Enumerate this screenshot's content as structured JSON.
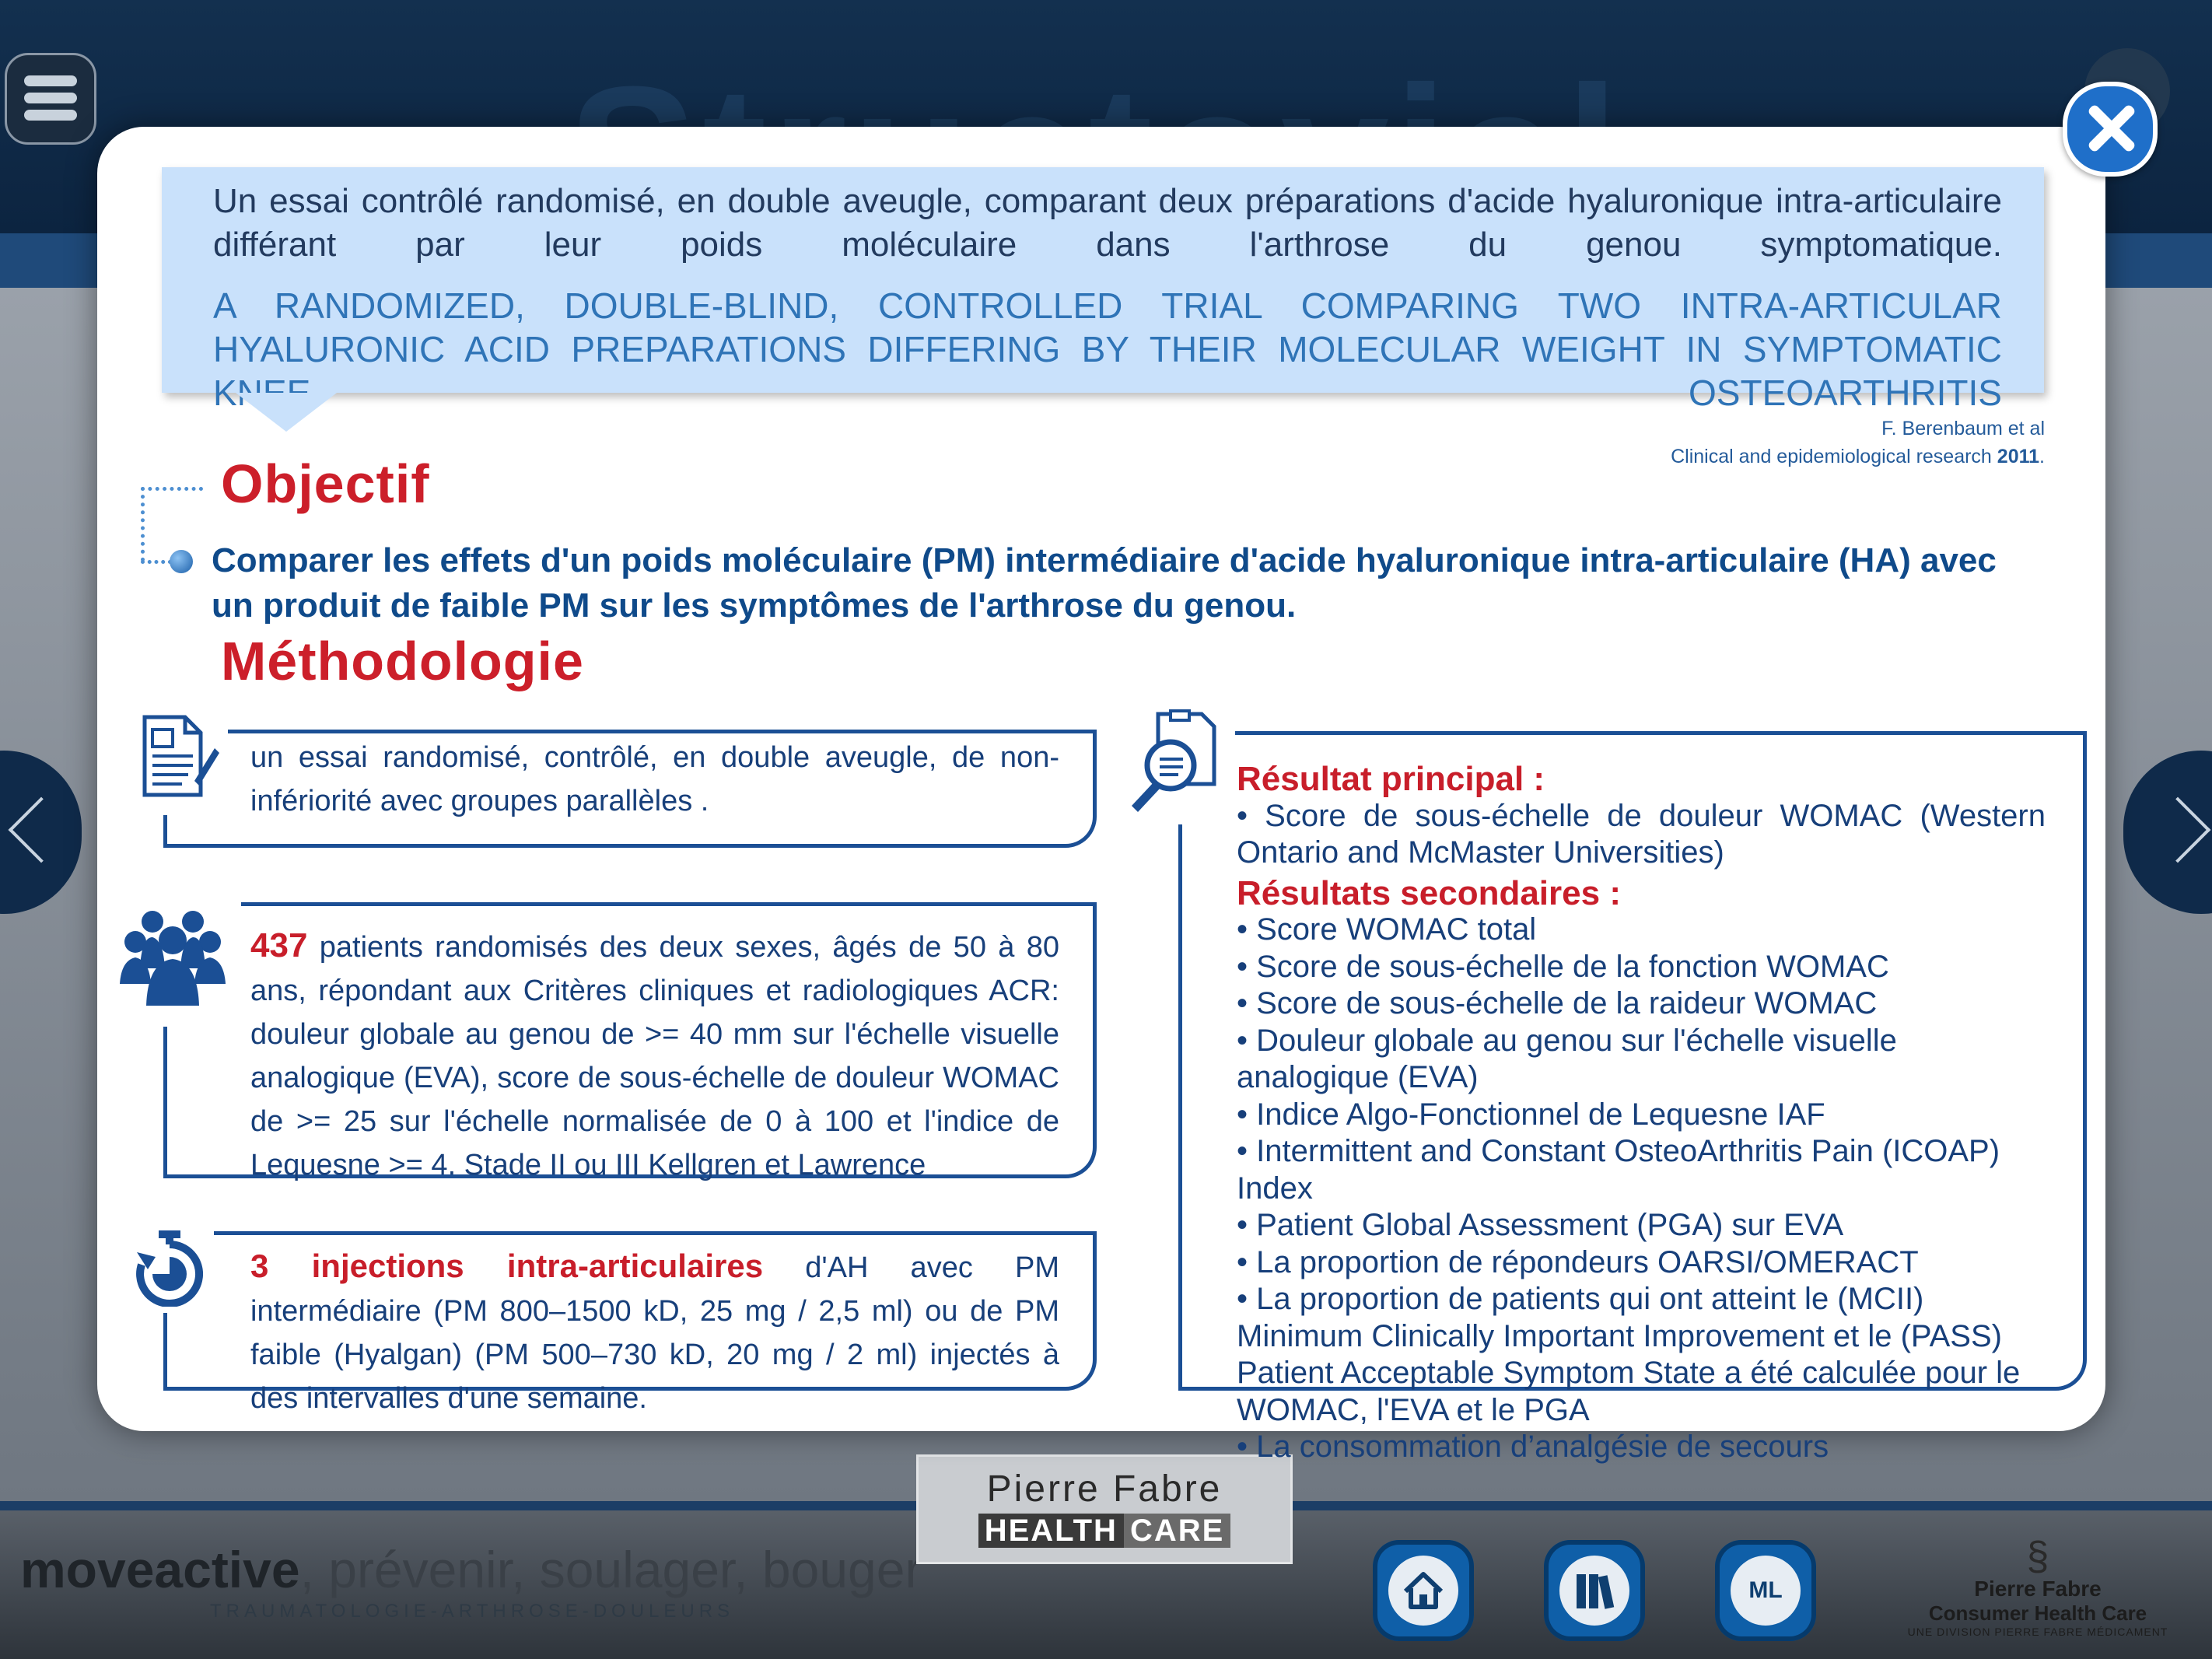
{
  "app": {
    "background_title": "Structovial",
    "brand": {
      "bold": "moveactive",
      "tagline": ", prévenir, soulager, bouger",
      "subtitle": "TRAUMATOLOGIE-ARTHROSE-DOULEURS"
    },
    "center_logo": {
      "line1": "Pierre Fabre",
      "line2a": "HEALTH",
      "line2b": "CARE"
    },
    "right_logo": {
      "line1": "Pierre Fabre",
      "line2": "Consumer Health Care",
      "line3": "UNE DIVISION PIERRE FABRE MÉDICAMENT"
    },
    "footer_buttons": [
      {
        "icon": "home-icon"
      },
      {
        "icon": "library-icon"
      },
      {
        "icon": "ml-icon",
        "label": "ML"
      }
    ],
    "colors": {
      "accent_red": "#cc1f2a",
      "accent_blue": "#1b4f95",
      "title_bg": "#c9e1fb"
    }
  },
  "modal": {
    "title_fr": "Un essai contrôlé randomisé, en double aveugle, comparant deux préparations d'acide hyaluronique intra-articulaire différant par leur poids moléculaire dans l'arthrose du genou symptomatique.",
    "title_en": "A RANDOMIZED, DOUBLE-BLIND, CONTROLLED TRIAL COMPARING TWO INTRA-ARTICULAR HYALURONIC ACID PREPARATIONS DIFFERING BY THEIR MOLECULAR WEIGHT IN SYMPTOMATIC KNEE OSTEOARTHRITIS",
    "reference": {
      "authors": "F. Berenbaum et al",
      "journal": "Clinical and epidemiological research",
      "year": "2011",
      "dot": "."
    },
    "objectif_heading": "Objectif",
    "objectif_text": "Comparer les effets d'un poids moléculaire (PM) intermédiaire  d'acide hyaluronique intra-articulaire (HA) avec un produit de faible PM sur les symptômes de l'arthrose du genou.",
    "methodologie_heading": "Méthodologie",
    "cards": {
      "design": "un essai randomisé, contrôlé, en double aveugle, de non-infériorité avec groupes parallèles .",
      "patients_count": "437",
      "patients_text": " patients randomisés des deux sexes, âgés de 50 à 80 ans, répondant aux Critères cliniques et radiologiques ACR: douleur globale au genou de >= 40 mm sur l'échelle visuelle analogique (EVA), score de sous-échelle de douleur WOMAC de >= 25 sur l'échelle normalisée de 0 à 100 et l'indice de Lequesne >= 4. Stade II ou III Kellgren et Lawrence",
      "injections_bold": "3 injections intra-articulaires",
      "injections_text": " d'AH avec PM intermédiaire (PM 800–1500 kD, 25 mg / 2,5 ml) ou de PM faible (Hyalgan) (PM 500–730 kD, 20 mg / 2 ml) injectés à des intervalles d'une semaine."
    },
    "results": {
      "primary_heading": "Résultat principal :",
      "primary_item": "• Score de sous-échelle de douleur WOMAC (Western Ontario and McMaster Universities)",
      "secondary_heading": "Résultats secondaires :",
      "secondary_items": [
        "• Score WOMAC total",
        "• Score de sous-échelle de la fonction WOMAC",
        "• Score de sous-échelle de la raideur WOMAC",
        "• Douleur globale au genou sur l'échelle visuelle analogique (EVA)",
        "• Indice Algo-Fonctionnel de Lequesne IAF",
        "• Intermittent and Constant OsteoArthritis Pain (ICOAP) Index",
        "• Patient Global Assessment (PGA) sur EVA",
        "• La proportion de répondeurs OARSI/OMERACT",
        "• La proportion de patients qui ont atteint le (MCII) Minimum Clinically Important Improvement et le (PASS) Patient Acceptable Symptom State a été calculée pour le WOMAC, l'EVA et le PGA",
        "• La consommation d’analgésie de secours"
      ]
    }
  }
}
